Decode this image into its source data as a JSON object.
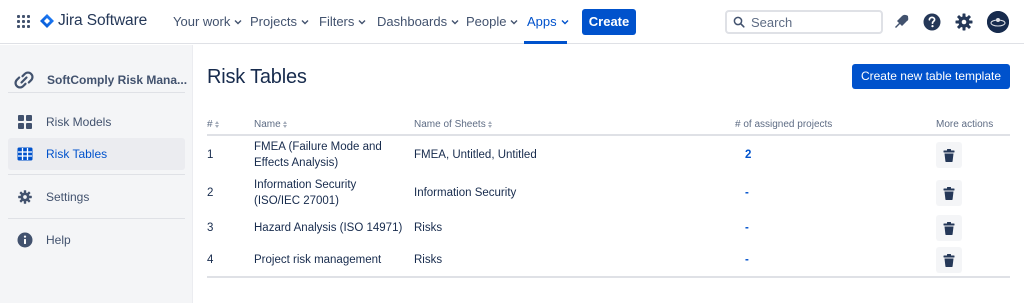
{
  "topnav": {
    "logo": "Jira Software",
    "items": [
      {
        "label": "Your work"
      },
      {
        "label": "Projects"
      },
      {
        "label": "Filters"
      },
      {
        "label": "Dashboards"
      },
      {
        "label": "People"
      },
      {
        "label": "Apps"
      }
    ],
    "active_item": "Apps",
    "create_label": "Create",
    "search_placeholder": "Search",
    "icons": [
      "notifications-icon",
      "help-icon",
      "settings-icon",
      "avatar"
    ]
  },
  "sidebar": {
    "project_name": "SoftComply Risk Mana...",
    "items": [
      {
        "label": "Risk Models",
        "icon": "dashboard-grid-icon"
      },
      {
        "label": "Risk Tables",
        "icon": "table-icon",
        "selected": true
      },
      {
        "label": "Settings",
        "icon": "gear-icon"
      },
      {
        "label": "Help",
        "icon": "info-icon"
      }
    ]
  },
  "main": {
    "title": "Risk Tables",
    "create_template_label": "Create new table template",
    "table": {
      "headers": [
        "#",
        "Name",
        "Name of Sheets",
        "# of assigned projects",
        "More actions"
      ],
      "rows": [
        {
          "num": "1",
          "name": [
            "FMEA (Failure Mode and",
            "Effects Analysis)"
          ],
          "sheets": "FMEA, Untitled, Untitled",
          "projects": "2"
        },
        {
          "num": "2",
          "name": [
            "Information Security",
            "(ISO/IEC 27001)"
          ],
          "sheets": "Information Security",
          "projects": "-"
        },
        {
          "num": "3",
          "name": [
            "Hazard Analysis (ISO 14971)"
          ],
          "sheets": "Risks",
          "projects": "-"
        },
        {
          "num": "4",
          "name": [
            "Project risk management"
          ],
          "sheets": "Risks",
          "projects": "-"
        }
      ]
    }
  },
  "colors": {
    "brand": "#0052cc",
    "text": "#172b4d",
    "muted": "#42526e",
    "sidebar_bg": "#f4f5f7"
  }
}
